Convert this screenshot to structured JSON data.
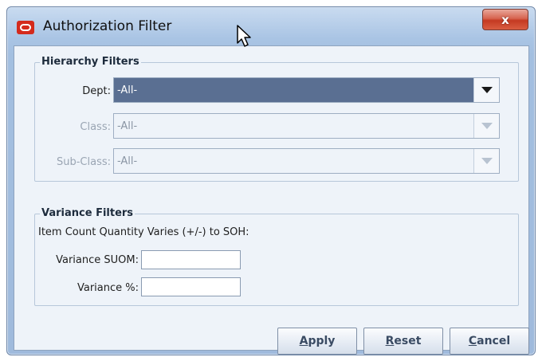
{
  "window": {
    "title": "Authorization Filter",
    "close_label": "x"
  },
  "hierarchy": {
    "legend": "Hierarchy Filters",
    "dept": {
      "label": "Dept:",
      "value": "-All-"
    },
    "class": {
      "label": "Class:",
      "value": "-All-"
    },
    "subclass": {
      "label": "Sub-Class:",
      "value": "-All-"
    }
  },
  "variance": {
    "legend": "Variance Filters",
    "description": "Item Count Quantity Varies (+/-) to SOH:",
    "suom": {
      "label": "Variance SUOM:",
      "value": ""
    },
    "percent": {
      "label": "Variance %:",
      "value": ""
    }
  },
  "buttons": {
    "apply": {
      "mnemonic": "A",
      "rest": "pply"
    },
    "reset": {
      "mnemonic": "R",
      "rest": "eset"
    },
    "cancel": {
      "mnemonic": "C",
      "rest": "ancel"
    }
  },
  "colors": {
    "accent_selected": "#5a6f92",
    "brand_icon": "#d42a1c",
    "close_button": "#c53a22"
  }
}
